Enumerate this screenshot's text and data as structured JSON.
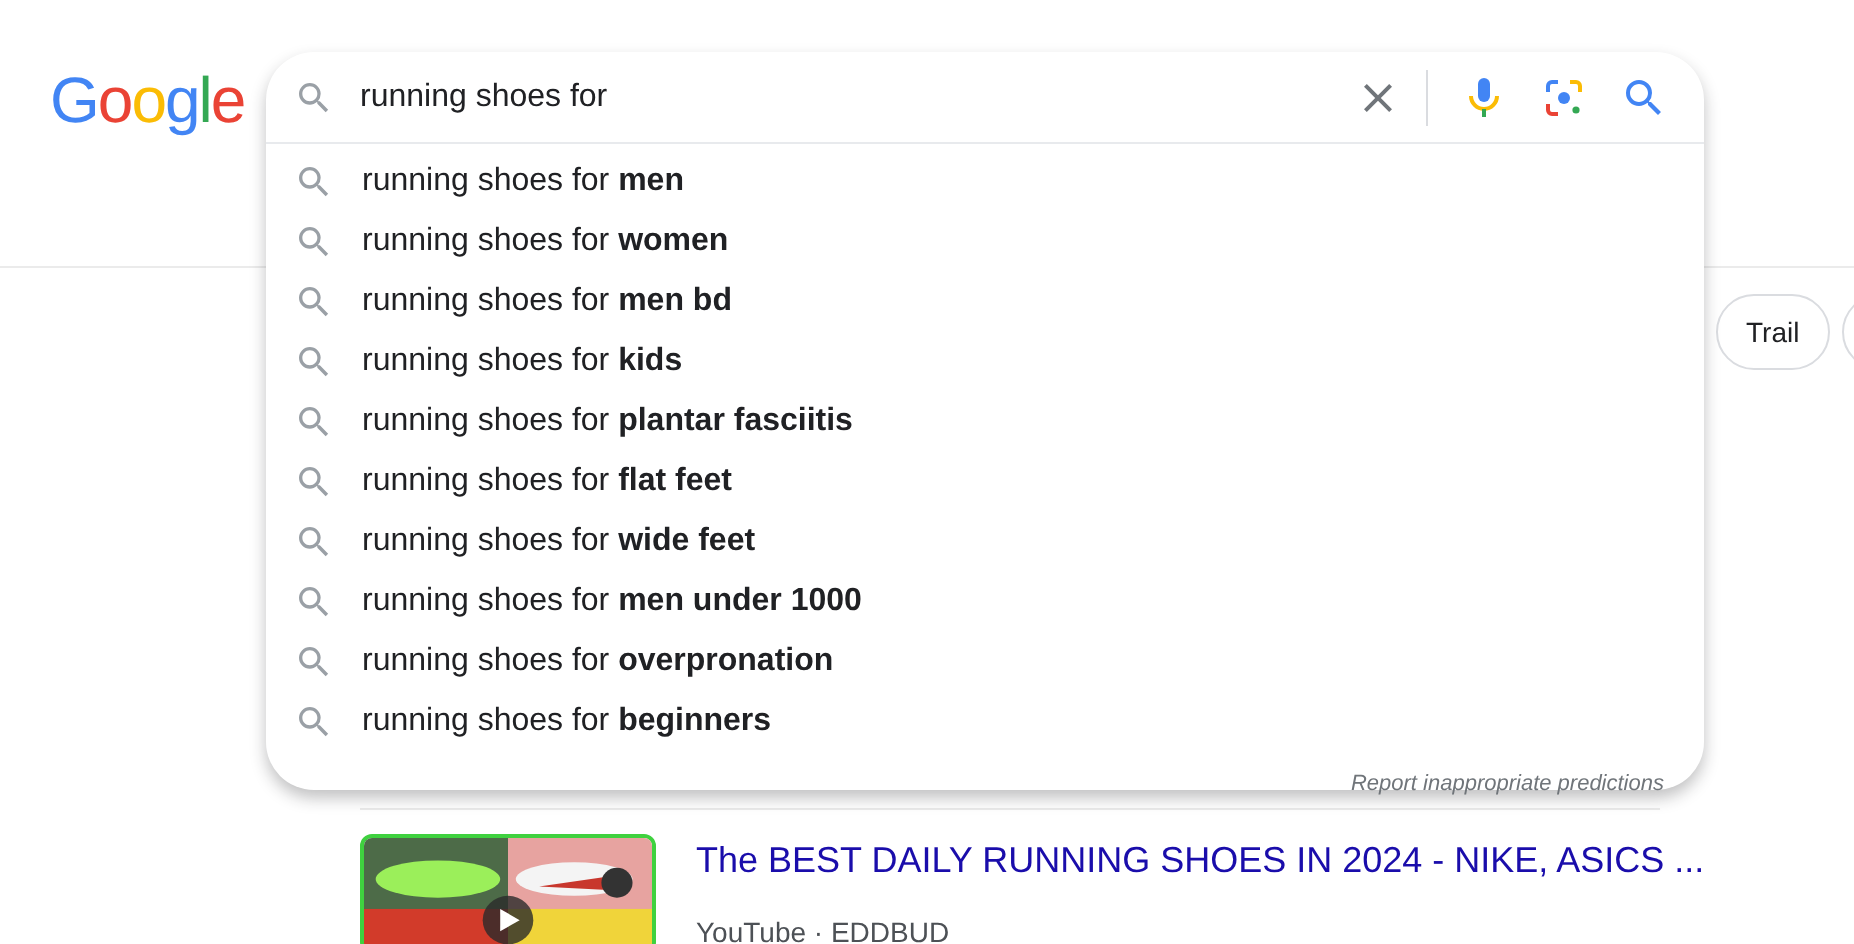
{
  "logo": "Google",
  "search": {
    "value": "running shoes for"
  },
  "suggestions": [
    "running shoes for **men**",
    "running shoes for **women**",
    "running shoes for **men bd**",
    "running shoes for **kids**",
    "running shoes for **plantar fasciitis**",
    "running shoes for **flat feet**",
    "running shoes for **wide feet**",
    "running shoes for **men under 1000**",
    "running shoes for **overpronation**",
    "running shoes for **beginners**"
  ],
  "report_link": "Report inappropriate predictions",
  "chips": [
    "Trail"
  ],
  "result": {
    "kind": "picture",
    "title": "The BEST DAILY RUNNING SHOES IN 2024 - NIKE, ASICS ...",
    "source": "YouTube · EDDBUD"
  }
}
